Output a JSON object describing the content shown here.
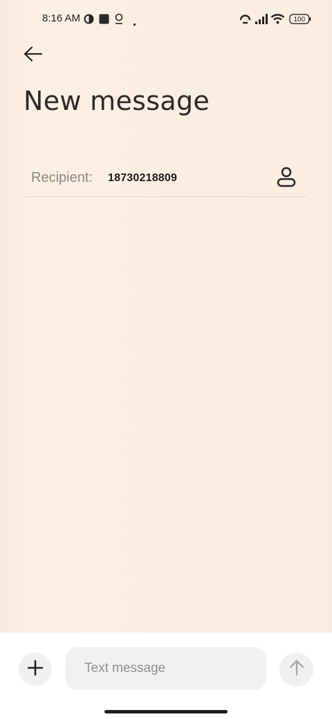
{
  "status_bar": {
    "time": "8:16 AM",
    "battery": "100",
    "icons": [
      "data-saver-icon",
      "square-app-icon",
      "location-pin-icon",
      "dot-icon",
      "hotspot-icon",
      "signal-icon",
      "wifi-icon",
      "battery-icon"
    ]
  },
  "header": {
    "back_icon": "arrow-left-icon",
    "title": "New message"
  },
  "recipient": {
    "label": "Recipient:",
    "value": "18730218809",
    "contact_icon": "person-icon"
  },
  "composer": {
    "add_icon": "plus-icon",
    "placeholder": "Text message",
    "send_icon": "arrow-up-icon"
  }
}
